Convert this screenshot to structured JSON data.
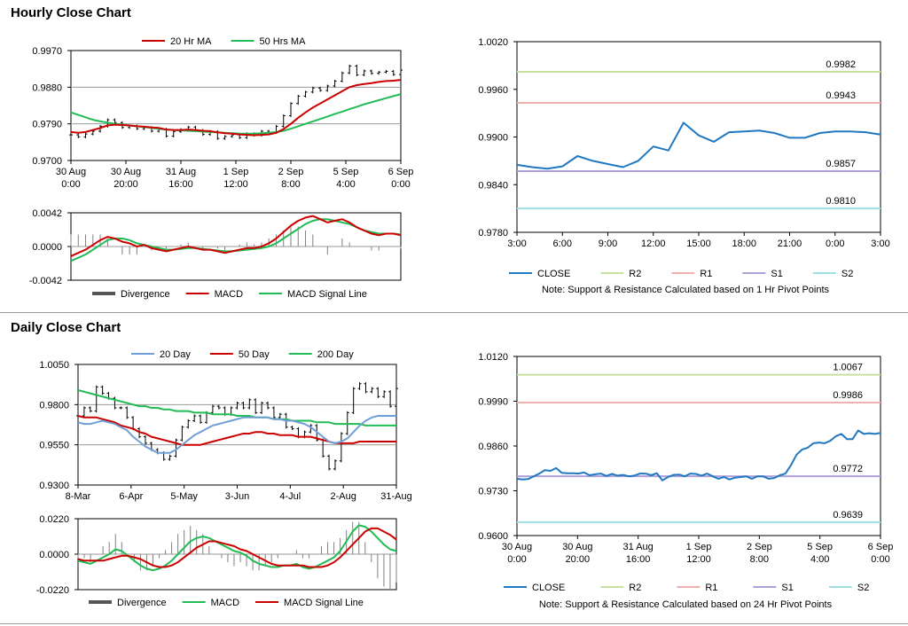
{
  "sections": {
    "hourly_title": "Hourly Close Chart",
    "daily_title": "Daily Close Chart"
  },
  "colors": {
    "red": "#cc0000",
    "green": "#22bb55",
    "blue": "#1f78c1",
    "lightblue": "#6f9fd6",
    "r2": "#c8e0a0",
    "r1": "#f0b0b0",
    "s1": "#b0a0d8",
    "s2": "#a0e0e0",
    "divergence": "#808080",
    "price": "#000000"
  },
  "chart_data": [
    {
      "id": "hourly_price",
      "type": "line",
      "title": "",
      "ylim": [
        0.97,
        0.997
      ],
      "y_ticks": [
        "0.9970",
        "0.9880",
        "0.9790",
        "0.9700"
      ],
      "x_ticks": [
        [
          "30 Aug",
          "0:00"
        ],
        [
          "30 Aug",
          "20:00"
        ],
        [
          "31 Aug",
          "16:00"
        ],
        [
          "1 Sep",
          "12:00"
        ],
        [
          "2 Sep",
          "8:00"
        ],
        [
          "5 Sep",
          "4:00"
        ],
        [
          "6 Sep",
          "0:00"
        ]
      ],
      "legend": [
        "20 Hr MA",
        "50 Hrs MA"
      ],
      "series": [
        {
          "name": "Price",
          "values": [
            0.9763,
            0.9758,
            0.9765,
            0.9772,
            0.9784,
            0.98,
            0.9793,
            0.9781,
            0.9785,
            0.9778,
            0.9781,
            0.9772,
            0.9777,
            0.976,
            0.9771,
            0.9776,
            0.9782,
            0.9774,
            0.9764,
            0.9771,
            0.9754,
            0.9759,
            0.9763,
            0.9756,
            0.9766,
            0.9762,
            0.9772,
            0.9769,
            0.9784,
            0.981,
            0.984,
            0.9858,
            0.9868,
            0.9878,
            0.9872,
            0.9883,
            0.9895,
            0.9915,
            0.9932,
            0.991,
            0.992,
            0.9914,
            0.9917,
            0.9919,
            0.9911,
            0.9922
          ]
        },
        {
          "name": "20 Hr MA",
          "values": [
            0.977,
            0.9768,
            0.977,
            0.9775,
            0.978,
            0.9786,
            0.9788,
            0.9787,
            0.9786,
            0.9784,
            0.9783,
            0.9781,
            0.978,
            0.9776,
            0.9775,
            0.9775,
            0.9776,
            0.9775,
            0.9773,
            0.9772,
            0.9769,
            0.9767,
            0.9766,
            0.9764,
            0.9763,
            0.9762,
            0.9763,
            0.9764,
            0.9768,
            0.9777,
            0.979,
            0.9805,
            0.9818,
            0.983,
            0.984,
            0.985,
            0.986,
            0.987,
            0.988,
            0.9885,
            0.9888,
            0.989,
            0.9893,
            0.9895,
            0.9896,
            0.9898
          ]
        },
        {
          "name": "50 Hrs MA",
          "values": [
            0.9818,
            0.9812,
            0.9806,
            0.98,
            0.9796,
            0.9793,
            0.979,
            0.9788,
            0.9786,
            0.9784,
            0.9782,
            0.978,
            0.9778,
            0.9776,
            0.9775,
            0.9774,
            0.9773,
            0.9772,
            0.9771,
            0.977,
            0.9769,
            0.9768,
            0.9767,
            0.9766,
            0.9766,
            0.9766,
            0.9767,
            0.9768,
            0.977,
            0.9773,
            0.9778,
            0.9784,
            0.979,
            0.9796,
            0.9802,
            0.9808,
            0.9814,
            0.982,
            0.9826,
            0.9832,
            0.9838,
            0.9843,
            0.9848,
            0.9853,
            0.9858,
            0.9863
          ]
        }
      ]
    },
    {
      "id": "hourly_macd",
      "type": "line",
      "title": "",
      "ylim": [
        -0.0042,
        0.0042
      ],
      "y_ticks": [
        "0.0042",
        "0.0000",
        "-0.0042"
      ],
      "legend": [
        "Divergence",
        "MACD",
        "MACD Signal Line"
      ],
      "series": [
        {
          "name": "MACD",
          "values": [
            -0.0012,
            -0.0008,
            -0.0004,
            0.0002,
            0.0008,
            0.0012,
            0.001,
            0.0006,
            0.0004,
            0.0,
            0.0002,
            -0.0002,
            -0.0004,
            -0.0006,
            -0.0004,
            -0.0002,
            0.0,
            -0.0002,
            -0.0004,
            -0.0004,
            -0.0006,
            -0.0008,
            -0.0006,
            -0.0004,
            -0.0002,
            -0.0002,
            0.0,
            0.0004,
            0.001,
            0.0018,
            0.0026,
            0.0032,
            0.0036,
            0.0038,
            0.0034,
            0.003,
            0.0032,
            0.0034,
            0.003,
            0.0024,
            0.002,
            0.0016,
            0.0014,
            0.0016,
            0.0016,
            0.0014
          ]
        },
        {
          "name": "MACD Signal Line",
          "values": [
            -0.0018,
            -0.0014,
            -0.001,
            -0.0004,
            0.0002,
            0.0008,
            0.001,
            0.001,
            0.0008,
            0.0004,
            0.0002,
            0.0,
            -0.0002,
            -0.0004,
            -0.0004,
            -0.0003,
            -0.0002,
            -0.0002,
            -0.0003,
            -0.0004,
            -0.0005,
            -0.0006,
            -0.0006,
            -0.0005,
            -0.0004,
            -0.0003,
            -0.0002,
            0.0,
            0.0004,
            0.001,
            0.0016,
            0.0022,
            0.0028,
            0.0032,
            0.0034,
            0.0034,
            0.0032,
            0.003,
            0.0028,
            0.0024,
            0.002,
            0.0018,
            0.0016,
            0.0016,
            0.0016,
            0.0015
          ]
        }
      ]
    },
    {
      "id": "hourly_pivot",
      "type": "line",
      "title": "",
      "ylim": [
        0.978,
        1.002
      ],
      "y_ticks": [
        "1.0020",
        "0.9960",
        "0.9900",
        "0.9840",
        "0.9780"
      ],
      "x_ticks": [
        "3:00",
        "6:00",
        "9:00",
        "12:00",
        "15:00",
        "18:00",
        "21:00",
        "0:00",
        "3:00"
      ],
      "levels": [
        {
          "name": "R2",
          "value": 0.9982,
          "label": "0.9982"
        },
        {
          "name": "R1",
          "value": 0.9943,
          "label": "0.9943"
        },
        {
          "name": "S1",
          "value": 0.9857,
          "label": "0.9857"
        },
        {
          "name": "S2",
          "value": 0.981,
          "label": "0.9810"
        }
      ],
      "legend": [
        "CLOSE",
        "R2",
        "R1",
        "S1",
        "S2"
      ],
      "note": "Note: Support & Resistance Calculated based on 1 Hr Pivot Points",
      "series": [
        {
          "name": "CLOSE",
          "x": [
            0,
            1,
            2,
            3,
            4,
            5,
            6,
            7,
            8,
            9,
            10,
            11,
            12,
            13,
            14,
            15,
            16,
            17,
            18,
            19,
            20,
            21,
            22,
            23,
            24
          ],
          "values": [
            0.9865,
            0.9862,
            0.986,
            0.9863,
            0.9876,
            0.987,
            0.9866,
            0.9862,
            0.987,
            0.9888,
            0.9883,
            0.9918,
            0.9902,
            0.9894,
            0.9906,
            0.9907,
            0.9908,
            0.9905,
            0.9899,
            0.9899,
            0.9905,
            0.9907,
            0.9907,
            0.9906,
            0.9903
          ]
        }
      ]
    },
    {
      "id": "daily_price",
      "type": "line",
      "title": "",
      "ylim": [
        0.93,
        1.005
      ],
      "y_ticks": [
        "1.0050",
        "0.9800",
        "0.9550",
        "0.9300"
      ],
      "x_ticks": [
        "8-Mar",
        "6-Apr",
        "5-May",
        "3-Jun",
        "4-Jul",
        "2-Aug",
        "31-Aug"
      ],
      "legend": [
        "20 Day",
        "50 Day",
        "200 Day"
      ],
      "series": [
        {
          "name": "Price",
          "values": [
            0.973,
            0.978,
            0.976,
            0.991,
            0.987,
            0.984,
            0.978,
            0.978,
            0.972,
            0.965,
            0.96,
            0.956,
            0.952,
            0.95,
            0.946,
            0.948,
            0.958,
            0.966,
            0.97,
            0.973,
            0.969,
            0.975,
            0.979,
            0.978,
            0.974,
            0.978,
            0.981,
            0.978,
            0.983,
            0.975,
            0.981,
            0.978,
            0.972,
            0.974,
            0.966,
            0.965,
            0.96,
            0.963,
            0.967,
            0.958,
            0.948,
            0.94,
            0.945,
            0.962,
            0.975,
            0.99,
            0.993,
            0.988,
            0.99,
            0.985,
            0.988,
            0.979,
            0.99
          ]
        },
        {
          "name": "20 Day",
          "values": [
            0.969,
            0.968,
            0.968,
            0.969,
            0.97,
            0.969,
            0.968,
            0.966,
            0.964,
            0.96,
            0.957,
            0.954,
            0.952,
            0.95,
            0.95,
            0.95,
            0.952,
            0.955,
            0.958,
            0.961,
            0.963,
            0.965,
            0.967,
            0.968,
            0.969,
            0.97,
            0.971,
            0.972,
            0.972,
            0.972,
            0.972,
            0.972,
            0.971,
            0.971,
            0.97,
            0.97,
            0.969,
            0.968,
            0.966,
            0.963,
            0.96,
            0.957,
            0.956,
            0.957,
            0.959,
            0.963,
            0.967,
            0.97,
            0.972,
            0.973,
            0.973,
            0.973,
            0.973
          ]
        },
        {
          "name": "50 Day",
          "values": [
            0.973,
            0.972,
            0.972,
            0.972,
            0.971,
            0.97,
            0.969,
            0.967,
            0.966,
            0.965,
            0.963,
            0.962,
            0.96,
            0.959,
            0.958,
            0.957,
            0.956,
            0.955,
            0.955,
            0.955,
            0.955,
            0.956,
            0.957,
            0.958,
            0.959,
            0.96,
            0.961,
            0.962,
            0.962,
            0.963,
            0.963,
            0.962,
            0.962,
            0.961,
            0.961,
            0.961,
            0.96,
            0.96,
            0.96,
            0.959,
            0.958,
            0.957,
            0.956,
            0.956,
            0.956,
            0.956,
            0.957,
            0.957,
            0.957,
            0.957,
            0.957,
            0.957,
            0.957
          ]
        },
        {
          "name": "200 Day",
          "values": [
            0.989,
            0.988,
            0.987,
            0.986,
            0.985,
            0.984,
            0.983,
            0.982,
            0.981,
            0.98,
            0.979,
            0.979,
            0.978,
            0.978,
            0.977,
            0.977,
            0.976,
            0.976,
            0.976,
            0.975,
            0.975,
            0.975,
            0.974,
            0.974,
            0.974,
            0.974,
            0.973,
            0.973,
            0.973,
            0.972,
            0.972,
            0.972,
            0.971,
            0.971,
            0.971,
            0.97,
            0.97,
            0.97,
            0.97,
            0.969,
            0.969,
            0.969,
            0.968,
            0.968,
            0.968,
            0.968,
            0.968,
            0.967,
            0.967,
            0.967,
            0.967,
            0.967,
            0.967
          ]
        }
      ]
    },
    {
      "id": "daily_macd",
      "type": "line",
      "title": "",
      "ylim": [
        -0.022,
        0.022
      ],
      "y_ticks": [
        "0.0220",
        "0.0000",
        "-0.0220"
      ],
      "legend": [
        "Divergence",
        "MACD",
        "MACD Signal Line"
      ],
      "series": [
        {
          "name": "MACD",
          "values": [
            -0.004,
            -0.005,
            -0.006,
            -0.004,
            -0.002,
            0.0,
            0.003,
            0.002,
            -0.001,
            -0.004,
            -0.007,
            -0.009,
            -0.01,
            -0.009,
            -0.007,
            -0.004,
            0.0,
            0.004,
            0.008,
            0.01,
            0.011,
            0.01,
            0.008,
            0.006,
            0.004,
            0.002,
            0.001,
            -0.001,
            -0.004,
            -0.006,
            -0.007,
            -0.008,
            -0.008,
            -0.007,
            -0.007,
            -0.006,
            -0.008,
            -0.009,
            -0.008,
            -0.006,
            -0.004,
            -0.002,
            0.002,
            0.008,
            0.014,
            0.018,
            0.017,
            0.014,
            0.01,
            0.006,
            0.003,
            0.002
          ]
        },
        {
          "name": "MACD Signal Line",
          "values": [
            -0.003,
            -0.004,
            -0.004,
            -0.004,
            -0.004,
            -0.003,
            -0.002,
            -0.001,
            -0.001,
            -0.002,
            -0.003,
            -0.005,
            -0.007,
            -0.008,
            -0.008,
            -0.007,
            -0.005,
            -0.002,
            0.001,
            0.004,
            0.006,
            0.008,
            0.008,
            0.007,
            0.006,
            0.005,
            0.003,
            0.002,
            0.0,
            -0.002,
            -0.004,
            -0.006,
            -0.007,
            -0.007,
            -0.007,
            -0.007,
            -0.007,
            -0.008,
            -0.008,
            -0.008,
            -0.007,
            -0.005,
            -0.002,
            0.002,
            0.006,
            0.01,
            0.014,
            0.016,
            0.016,
            0.014,
            0.012,
            0.009
          ]
        }
      ]
    },
    {
      "id": "daily_pivot",
      "type": "line",
      "title": "",
      "ylim": [
        0.96,
        1.012
      ],
      "y_ticks": [
        "1.0120",
        "0.9990",
        "0.9860",
        "0.9730",
        "0.9600"
      ],
      "x_ticks": [
        [
          "30 Aug",
          "0:00"
        ],
        [
          "30 Aug",
          "20:00"
        ],
        [
          "31 Aug",
          "16:00"
        ],
        [
          "1 Sep",
          "12:00"
        ],
        [
          "2 Sep",
          "8:00"
        ],
        [
          "5 Sep",
          "4:00"
        ],
        [
          "6 Sep",
          "0:00"
        ]
      ],
      "levels": [
        {
          "name": "R2",
          "value": 1.0067,
          "label": "1.0067"
        },
        {
          "name": "R1",
          "value": 0.9986,
          "label": "0.9986"
        },
        {
          "name": "S1",
          "value": 0.9772,
          "label": "0.9772"
        },
        {
          "name": "S2",
          "value": 0.9639,
          "label": "0.9639"
        }
      ],
      "legend": [
        "CLOSE",
        "R2",
        "R1",
        "S1",
        "S2"
      ],
      "note": "Note: Support & Resistance Calculated based on 24 Hr Pivot Points",
      "series": [
        {
          "name": "CLOSE",
          "values": [
            0.9765,
            0.9763,
            0.9764,
            0.9772,
            0.978,
            0.979,
            0.9788,
            0.9796,
            0.9782,
            0.9781,
            0.9781,
            0.978,
            0.9783,
            0.9775,
            0.9778,
            0.978,
            0.9773,
            0.9779,
            0.9774,
            0.9776,
            0.9772,
            0.9774,
            0.978,
            0.978,
            0.9775,
            0.9781,
            0.976,
            0.977,
            0.9776,
            0.9777,
            0.9772,
            0.978,
            0.9779,
            0.9774,
            0.978,
            0.9772,
            0.9765,
            0.977,
            0.9763,
            0.9768,
            0.977,
            0.9772,
            0.9765,
            0.9772,
            0.9772,
            0.9765,
            0.9767,
            0.9775,
            0.978,
            0.9805,
            0.9835,
            0.985,
            0.9855,
            0.9868,
            0.987,
            0.9868,
            0.9875,
            0.9888,
            0.9895,
            0.988,
            0.988,
            0.9905,
            0.9895,
            0.9897,
            0.9895,
            0.9898
          ]
        }
      ]
    }
  ]
}
